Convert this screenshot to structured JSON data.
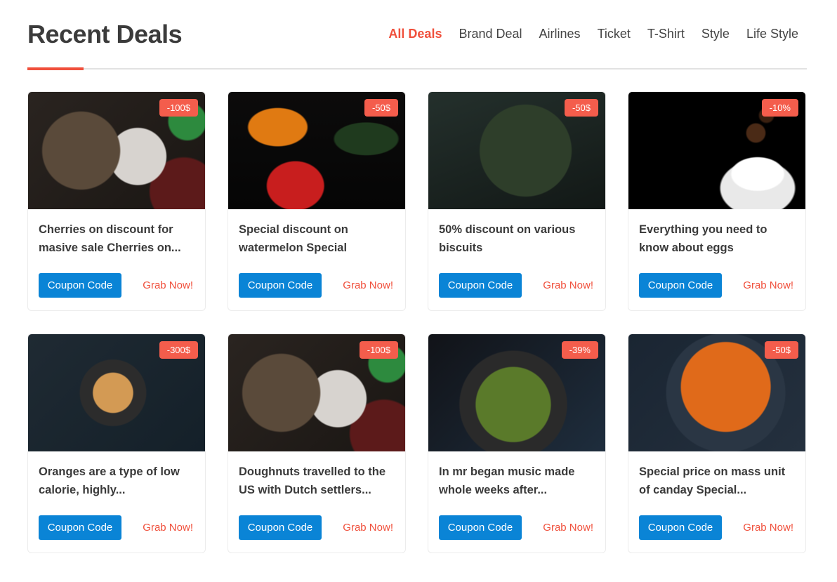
{
  "header": {
    "title": "Recent Deals",
    "nav": [
      {
        "label": "All Deals",
        "active": true
      },
      {
        "label": "Brand Deal",
        "active": false
      },
      {
        "label": "Airlines",
        "active": false
      },
      {
        "label": "Ticket",
        "active": false
      },
      {
        "label": "T-Shirt",
        "active": false
      },
      {
        "label": "Style",
        "active": false
      },
      {
        "label": "Life Style",
        "active": false
      }
    ]
  },
  "colors": {
    "accent": "#f0503c",
    "button": "#0a84d6",
    "badge": "#f45d4c"
  },
  "deals": [
    {
      "badge": "-100$",
      "title": "Cherries on discount for masive sale Cherries on...",
      "button": "Coupon Code",
      "link": "Grab Now!",
      "image": "coffee-table"
    },
    {
      "badge": "-50$",
      "title": "Special discount on watermelon Special",
      "button": "Coupon Code",
      "link": "Grab Now!",
      "image": "peppers"
    },
    {
      "badge": "-50$",
      "title": "50% discount on various biscuits",
      "button": "Coupon Code",
      "link": "Grab Now!",
      "image": "eggs"
    },
    {
      "badge": "-10%",
      "title": "Everything you need to know about eggs",
      "button": "Coupon Code",
      "link": "Grab Now!",
      "image": "cup"
    },
    {
      "badge": "-300$",
      "title": "Oranges are a type of low calorie, highly...",
      "button": "Coupon Code",
      "link": "Grab Now!",
      "image": "orange-pan"
    },
    {
      "badge": "-100$",
      "title": "Doughnuts travelled to the US with Dutch settlers...",
      "button": "Coupon Code",
      "link": "Grab Now!",
      "image": "coffee-table"
    },
    {
      "badge": "-39%",
      "title": "In mr began music made whole weeks after...",
      "button": "Coupon Code",
      "link": "Grab Now!",
      "image": "salad"
    },
    {
      "badge": "-50$",
      "title": "Special price on mass unit of canday Special...",
      "button": "Coupon Code",
      "link": "Grab Now!",
      "image": "soup"
    }
  ]
}
